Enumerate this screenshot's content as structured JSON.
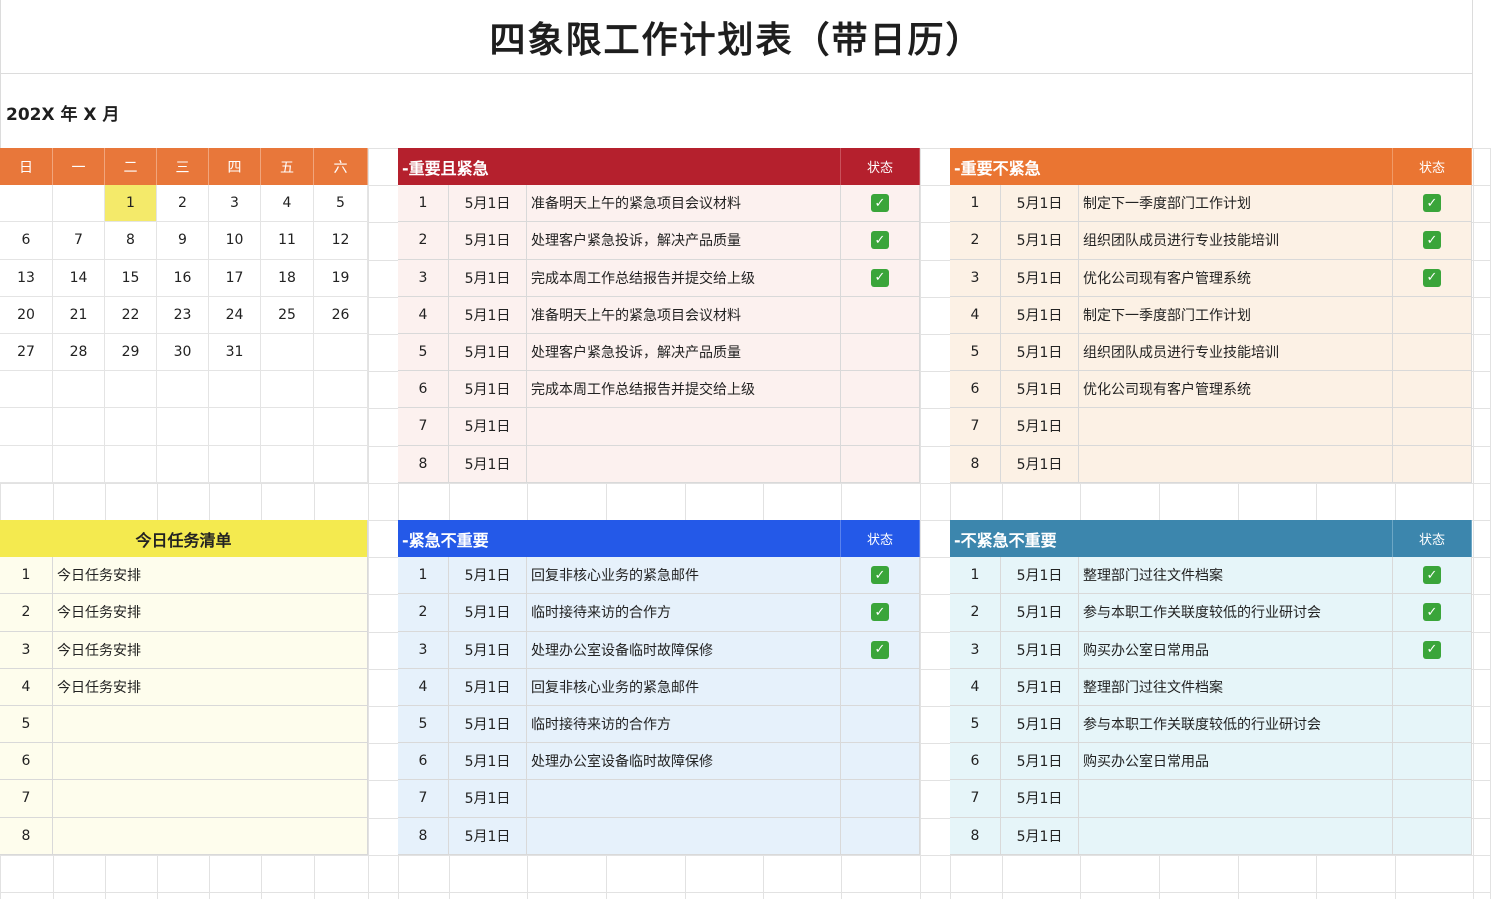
{
  "title": "四象限工作计划表（带日历）",
  "month_label": "202X 年 X 月",
  "calendar": {
    "weekdays": [
      "日",
      "一",
      "二",
      "三",
      "四",
      "五",
      "六"
    ],
    "weeks": [
      [
        "",
        "",
        "1",
        "2",
        "3",
        "4",
        "5"
      ],
      [
        "6",
        "7",
        "8",
        "9",
        "10",
        "11",
        "12"
      ],
      [
        "13",
        "14",
        "15",
        "16",
        "17",
        "18",
        "19"
      ],
      [
        "20",
        "21",
        "22",
        "23",
        "24",
        "25",
        "26"
      ],
      [
        "27",
        "28",
        "29",
        "30",
        "31",
        "",
        ""
      ],
      [
        "",
        "",
        "",
        "",
        "",
        "",
        ""
      ],
      [
        "",
        "",
        "",
        "",
        "",
        "",
        ""
      ],
      [
        "",
        "",
        "",
        "",
        "",
        "",
        ""
      ]
    ],
    "today": "1"
  },
  "status_label": "状态",
  "q1": {
    "title": "-重要且紧急",
    "rows": [
      {
        "no": "1",
        "date": "5月1日",
        "task": "准备明天上午的紧急项目会议材料",
        "done": true
      },
      {
        "no": "2",
        "date": "5月1日",
        "task": "处理客户紧急投诉，解决产品质量",
        "done": true
      },
      {
        "no": "3",
        "date": "5月1日",
        "task": "完成本周工作总结报告并提交给上级",
        "done": true
      },
      {
        "no": "4",
        "date": "5月1日",
        "task": "准备明天上午的紧急项目会议材料",
        "done": false
      },
      {
        "no": "5",
        "date": "5月1日",
        "task": "处理客户紧急投诉，解决产品质量",
        "done": false
      },
      {
        "no": "6",
        "date": "5月1日",
        "task": "完成本周工作总结报告并提交给上级",
        "done": false
      },
      {
        "no": "7",
        "date": "5月1日",
        "task": "",
        "done": false
      },
      {
        "no": "8",
        "date": "5月1日",
        "task": "",
        "done": false
      }
    ]
  },
  "q2": {
    "title": "-重要不紧急",
    "rows": [
      {
        "no": "1",
        "date": "5月1日",
        "task": "制定下一季度部门工作计划",
        "done": true
      },
      {
        "no": "2",
        "date": "5月1日",
        "task": "组织团队成员进行专业技能培训",
        "done": true
      },
      {
        "no": "3",
        "date": "5月1日",
        "task": "优化公司现有客户管理系统",
        "done": true
      },
      {
        "no": "4",
        "date": "5月1日",
        "task": "制定下一季度部门工作计划",
        "done": false
      },
      {
        "no": "5",
        "date": "5月1日",
        "task": "组织团队成员进行专业技能培训",
        "done": false
      },
      {
        "no": "6",
        "date": "5月1日",
        "task": "优化公司现有客户管理系统",
        "done": false
      },
      {
        "no": "7",
        "date": "5月1日",
        "task": "",
        "done": false
      },
      {
        "no": "8",
        "date": "5月1日",
        "task": "",
        "done": false
      }
    ]
  },
  "today_list": {
    "title": "今日任务清单",
    "rows": [
      {
        "no": "1",
        "task": "今日任务安排"
      },
      {
        "no": "2",
        "task": "今日任务安排"
      },
      {
        "no": "3",
        "task": "今日任务安排"
      },
      {
        "no": "4",
        "task": "今日任务安排"
      },
      {
        "no": "5",
        "task": ""
      },
      {
        "no": "6",
        "task": ""
      },
      {
        "no": "7",
        "task": ""
      },
      {
        "no": "8",
        "task": ""
      }
    ]
  },
  "q3": {
    "title": "-紧急不重要",
    "rows": [
      {
        "no": "1",
        "date": "5月1日",
        "task": "回复非核心业务的紧急邮件",
        "done": true
      },
      {
        "no": "2",
        "date": "5月1日",
        "task": "临时接待来访的合作方",
        "done": true
      },
      {
        "no": "3",
        "date": "5月1日",
        "task": "处理办公室设备临时故障保修",
        "done": true
      },
      {
        "no": "4",
        "date": "5月1日",
        "task": "回复非核心业务的紧急邮件",
        "done": false
      },
      {
        "no": "5",
        "date": "5月1日",
        "task": "临时接待来访的合作方",
        "done": false
      },
      {
        "no": "6",
        "date": "5月1日",
        "task": "处理办公室设备临时故障保修",
        "done": false
      },
      {
        "no": "7",
        "date": "5月1日",
        "task": "",
        "done": false
      },
      {
        "no": "8",
        "date": "5月1日",
        "task": "",
        "done": false
      }
    ]
  },
  "q4": {
    "title": "-不紧急不重要",
    "rows": [
      {
        "no": "1",
        "date": "5月1日",
        "task": "整理部门过往文件档案",
        "done": true
      },
      {
        "no": "2",
        "date": "5月1日",
        "task": "参与本职工作关联度较低的行业研讨会",
        "done": true
      },
      {
        "no": "3",
        "date": "5月1日",
        "task": "购买办公室日常用品",
        "done": true
      },
      {
        "no": "4",
        "date": "5月1日",
        "task": "整理部门过往文件档案",
        "done": false
      },
      {
        "no": "5",
        "date": "5月1日",
        "task": "参与本职工作关联度较低的行业研讨会",
        "done": false
      },
      {
        "no": "6",
        "date": "5月1日",
        "task": "购买办公室日常用品",
        "done": false
      },
      {
        "no": "7",
        "date": "5月1日",
        "task": "",
        "done": false
      },
      {
        "no": "8",
        "date": "5月1日",
        "task": "",
        "done": false
      }
    ]
  },
  "colors": {
    "calendar_header": "#e8773a",
    "q1": "#b5202d",
    "q2": "#ea7532",
    "q3": "#2459e8",
    "q4": "#3c86ad",
    "today_list": "#f4ea4f",
    "check": "#3aa53a"
  },
  "icons": {
    "done": "check-mark-icon"
  }
}
